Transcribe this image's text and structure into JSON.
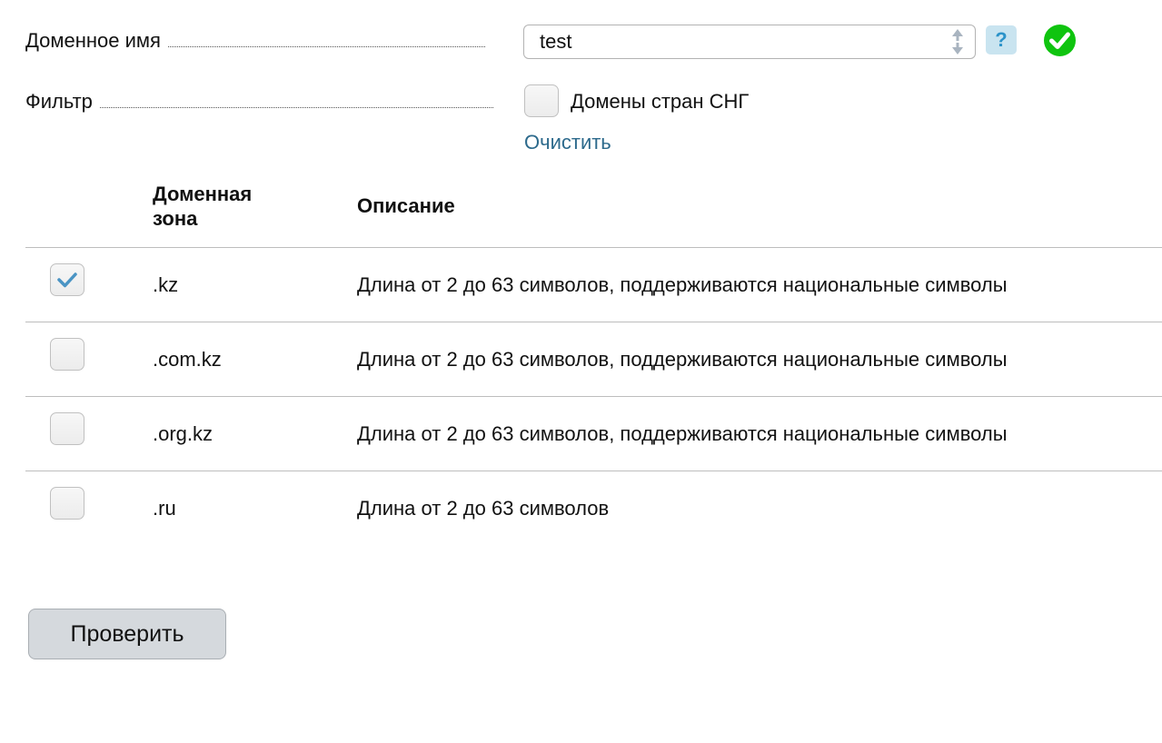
{
  "form": {
    "domain_label": "Доменное имя",
    "domain_value": "test",
    "help_label": "?",
    "filter_label": "Фильтр",
    "cis_label": "Домены стран СНГ",
    "cis_checked": false,
    "clear_label": "Очистить"
  },
  "table": {
    "headers": {
      "zone": "Доменная\nзона",
      "description": "Описание"
    },
    "rows": [
      {
        "zone": ".kz",
        "description": "Длина от 2 до 63 символов, поддерживаются национальные символы",
        "checked": true
      },
      {
        "zone": ".com.kz",
        "description": "Длина от 2 до 63 символов, поддерживаются национальные символы",
        "checked": false
      },
      {
        "zone": ".org.kz",
        "description": "Длина от 2 до 63 символов, поддерживаются национальные символы",
        "checked": false
      },
      {
        "zone": ".ru",
        "description": "Длина от 2 до 63 символов",
        "checked": false
      }
    ]
  },
  "actions": {
    "check_label": "Проверить"
  },
  "colors": {
    "link": "#2d6a8c",
    "ok_green": "#0fc40f",
    "help_bg": "#c9e4f0",
    "check_mark": "#4a94c4"
  },
  "icons": {
    "spinner": "up-down-arrows-icon",
    "status": "check-circle-icon",
    "help": "question-icon"
  }
}
